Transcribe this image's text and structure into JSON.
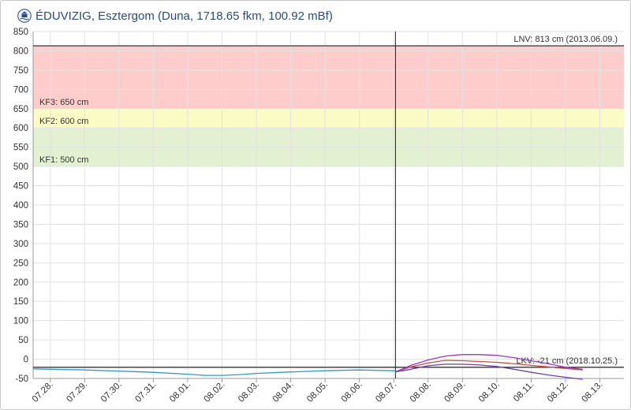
{
  "header": {
    "title": "ÉDUVIZIG, Esztergom (Duna, 1718.65 fkm, 100.92 mBf)",
    "logo_icon": "eduvizig-logo-icon"
  },
  "chart_data": {
    "type": "line",
    "title": "ÉDUVIZIG, Esztergom (Duna, 1718.65 fkm, 100.92 mBf)",
    "xlabel": "",
    "ylabel": "",
    "x_tick_labels": [
      "07.28.",
      "07.29.",
      "07.30.",
      "07.31.",
      "08.01.",
      "08.02.",
      "08.03.",
      "08.04.",
      "08.05.",
      "08.06.",
      "08.07.",
      "08.08.",
      "08.09.",
      "08.10.",
      "08.11.",
      "08.12.",
      "08.13."
    ],
    "x_range": [
      -0.5,
      16.7
    ],
    "ylim": [
      -50,
      850
    ],
    "y_ticks": [
      -50,
      0,
      50,
      100,
      150,
      200,
      250,
      300,
      350,
      400,
      450,
      500,
      550,
      600,
      650,
      700,
      750,
      800,
      850
    ],
    "grid": true,
    "current_time_x": 10.05,
    "bands": [
      {
        "from": 500,
        "to": 600,
        "color": "#e3f0d2"
      },
      {
        "from": 600,
        "to": 650,
        "color": "#fbfbc6"
      },
      {
        "from": 650,
        "to": 813,
        "color": "#ffcccc"
      }
    ],
    "reference_lines": [
      {
        "value": 813,
        "label": "LNV: 813 cm (2013.06.09.)",
        "position": "top-right"
      },
      {
        "value": -21,
        "label": "LKV: -21 cm (2018.10.25.)",
        "position": "right"
      }
    ],
    "band_labels": [
      {
        "value": 650,
        "label": "KF3: 650 cm"
      },
      {
        "value": 600,
        "label": "KF2: 600 cm"
      },
      {
        "value": 500,
        "label": "KF1: 500 cm"
      }
    ],
    "series": [
      {
        "color": "#2a9ad4",
        "points": [
          [
            -0.5,
            -25
          ],
          [
            0,
            -26
          ],
          [
            1,
            -28
          ],
          [
            2,
            -31
          ],
          [
            3,
            -34
          ],
          [
            4,
            -39
          ],
          [
            4.5,
            -42
          ],
          [
            5,
            -42
          ],
          [
            5.5,
            -40
          ],
          [
            6,
            -37
          ],
          [
            7,
            -33
          ],
          [
            8,
            -30
          ],
          [
            9,
            -28
          ],
          [
            10,
            -30
          ],
          [
            10.05,
            -31
          ]
        ]
      },
      {
        "color": "#d44a3a",
        "points": [
          [
            10.05,
            -33
          ],
          [
            10.5,
            -20
          ],
          [
            11,
            -10
          ],
          [
            11.5,
            -3
          ],
          [
            12,
            -4
          ],
          [
            12.5,
            -6
          ],
          [
            13,
            -8
          ],
          [
            13.5,
            -12
          ],
          [
            14,
            -16
          ],
          [
            14.5,
            -20
          ],
          [
            15,
            -24
          ],
          [
            15.5,
            -28
          ]
        ]
      },
      {
        "color": "#9b35d8",
        "points": [
          [
            10.05,
            -33
          ],
          [
            10.5,
            -16
          ],
          [
            11,
            -2
          ],
          [
            11.5,
            8
          ],
          [
            12,
            12
          ],
          [
            12.5,
            12
          ],
          [
            13,
            10
          ],
          [
            13.5,
            4
          ],
          [
            14,
            -4
          ],
          [
            14.5,
            -12
          ],
          [
            15,
            -21
          ],
          [
            15.5,
            -26
          ]
        ]
      },
      {
        "color": "#6a3fb5",
        "points": [
          [
            10.05,
            -33
          ],
          [
            10.5,
            -26
          ],
          [
            11,
            -17
          ],
          [
            11.5,
            -13
          ],
          [
            12,
            -13
          ],
          [
            12.5,
            -15
          ],
          [
            13,
            -19
          ],
          [
            13.5,
            -26
          ],
          [
            14,
            -34
          ],
          [
            14.5,
            -41
          ],
          [
            15,
            -47
          ],
          [
            15.5,
            -52
          ]
        ]
      }
    ]
  }
}
